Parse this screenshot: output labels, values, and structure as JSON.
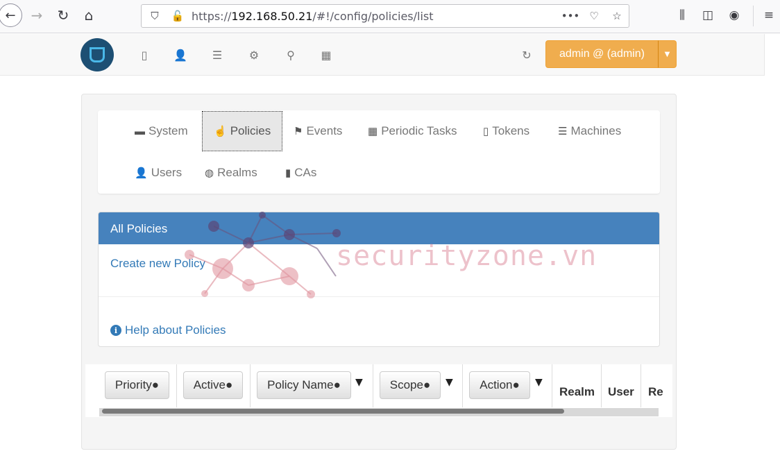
{
  "browser": {
    "url_scheme": "https://",
    "url_host": "192.168.50.21",
    "url_path": "/#!/config/policies/list"
  },
  "navbar": {
    "admin_label": "admin @ (admin)"
  },
  "config_tabs": [
    {
      "label": "System",
      "icon": "briefcase-icon"
    },
    {
      "label": "Policies",
      "icon": "hand-pointer-icon",
      "active": true
    },
    {
      "label": "Events",
      "icon": "flag-icon"
    },
    {
      "label": "Periodic Tasks",
      "icon": "calendar-icon"
    },
    {
      "label": "Tokens",
      "icon": "mobile-icon"
    },
    {
      "label": "Machines",
      "icon": "server-icon"
    },
    {
      "label": "Users",
      "icon": "user-icon"
    },
    {
      "label": "Realms",
      "icon": "globe-icon"
    },
    {
      "label": "CAs",
      "icon": "bookmark-icon"
    }
  ],
  "policies_panel": {
    "heading": "All Policies",
    "create_link": "Create new Policy",
    "help_link": "Help about Policies"
  },
  "watermark": {
    "text": "securityzone.vn"
  },
  "table": {
    "sort_columns": [
      {
        "label": "Priority●"
      },
      {
        "label": "Active●"
      },
      {
        "label": "Policy Name●"
      },
      {
        "label": "Scope●"
      },
      {
        "label": "Action●"
      }
    ],
    "plain_columns": [
      "Realm",
      "User",
      "Re"
    ]
  },
  "colors": {
    "panel_header": "#4682bd",
    "admin_button": "#f0ad4e",
    "link": "#337ab7"
  }
}
